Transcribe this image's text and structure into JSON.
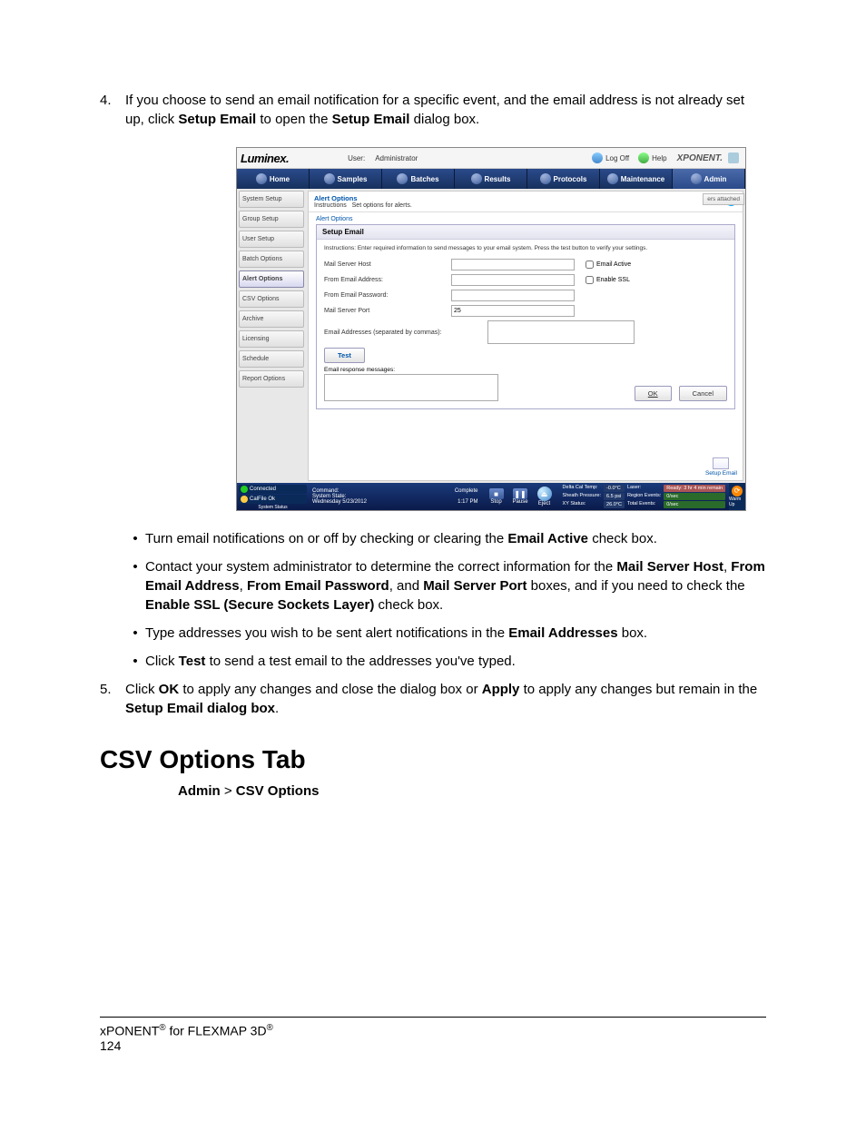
{
  "step4": {
    "num": "4.",
    "text_a": "If you choose to send an email notification for a specific event, and the email address is not already set up, click ",
    "b1": "Setup Email",
    "text_b": " to open the ",
    "b2": "Setup Email",
    "text_c": " dialog box."
  },
  "bullets": {
    "b1_a": "Turn email notifications on or off by checking or clearing the ",
    "b1_bold": "Email Active",
    "b1_b": " check box.",
    "b2_a": "Contact your system administrator to determine the correct information for the ",
    "b2_bold1": "Mail Server Host",
    "b2_s1": ", ",
    "b2_bold2": "From Email Address",
    "b2_s2": ", ",
    "b2_bold3": "From Email Password",
    "b2_s3": ", and ",
    "b2_bold4": "Mail Server Port",
    "b2_b": " boxes, and if you need to check the ",
    "b2_bold5": "Enable SSL (Secure Sockets Layer)",
    "b2_c": " check box.",
    "b3_a": "Type addresses you wish to be sent alert notifications in the ",
    "b3_bold": "Email Addresses",
    "b3_b": " box.",
    "b4_a": "Click ",
    "b4_bold": "Test",
    "b4_b": " to send a test email to the addresses you've typed."
  },
  "step5": {
    "num": "5.",
    "text_a": "Click ",
    "b1": "OK",
    "text_b": " to apply any changes and close the dialog box or ",
    "b2": "Apply",
    "text_c": " to apply any changes but remain in the ",
    "b3": "Setup Email dialog box",
    "text_d": "."
  },
  "section_heading": "CSV Options Tab",
  "breadcrumb": {
    "a": "Admin",
    "sep": " > ",
    "b": "CSV Options"
  },
  "footer": {
    "line1_a": "xPONENT",
    "reg": "®",
    "line1_b": " for FLEXMAP 3D",
    "page": "124"
  },
  "ss": {
    "brand": "Luminex.",
    "user_lbl": "User:",
    "user_val": "Administrator",
    "logoff": "Log Off",
    "help": "Help",
    "logo2": "XPONENT.",
    "tabs": [
      "Home",
      "Samples",
      "Batches",
      "Results",
      "Protocols",
      "Maintenance",
      "Admin"
    ],
    "sidebar": [
      "System Setup",
      "Group Setup",
      "User Setup",
      "Batch Options",
      "Alert Options",
      "CSV Options",
      "Archive",
      "Licensing",
      "Schedule",
      "Report Options"
    ],
    "ribbon_title": "Alert Options",
    "ribbon_sub": "Instructions",
    "ribbon_desc": "Set options for alerts.",
    "fieldset": "Alert Options",
    "overflow": "ers attached",
    "dialog": {
      "title": "Setup Email",
      "instruct": "Instructions: Enter required information to send messages to your email system. Press the test button to verify your settings.",
      "mail_host": "Mail Server Host",
      "from_addr": "From Email Address:",
      "from_pwd": "From Email Password:",
      "port_lbl": "Mail Server Port",
      "port_val": "25",
      "addr_lbl": "Email Addresses (separated by commas):",
      "email_active": "Email Active",
      "enable_ssl": "Enable SSL",
      "test": "Test",
      "resp": "Email response messages:",
      "ok": "OK",
      "cancel": "Cancel"
    },
    "setup_email_btn": "Setup Email",
    "status": {
      "connected": "Connected",
      "calfile": "CalFile Ok",
      "sysstatus": "System Status",
      "cmd": "Command:",
      "state": "System State:",
      "date": "Wednesday 5/23/2012",
      "time": "1:17 PM",
      "complete": "Complete",
      "stop": "Stop",
      "pause": "Pause",
      "eject": "Eject",
      "dct_lbl": "Delta Cal Temp:",
      "dct_val": "-0.0°C",
      "sp_lbl": "Sheath Pressure:",
      "sp_val": "6.5 psi",
      "xy_lbl": "XY Status:",
      "xy_val": "26.0°C",
      "laser_lbl": "Laser:",
      "laser_val": "Ready: 3 hr 4 min remain",
      "re_lbl": "Region Events:",
      "re_val": "0/sec",
      "te_lbl": "Total Events:",
      "te_val": "0/sec",
      "warm": "Warm Up"
    }
  }
}
